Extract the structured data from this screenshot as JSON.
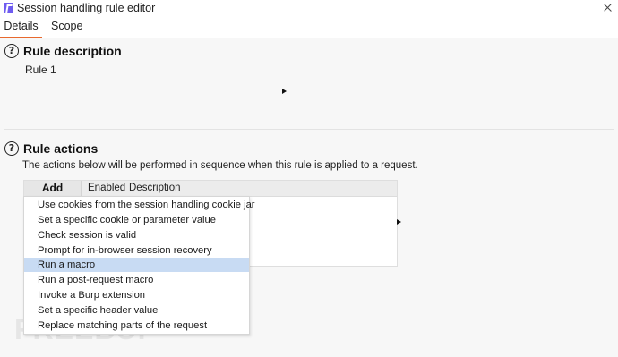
{
  "window": {
    "title": "Session handling rule editor",
    "accent_color": "#6f5cf0",
    "tab_underline_color": "#e8692e"
  },
  "tabs": [
    {
      "label": "Details",
      "active": true
    },
    {
      "label": "Scope",
      "active": false
    }
  ],
  "rule_description": {
    "heading": "Rule description",
    "help_icon": "question-circle-icon",
    "value": "Rule 1"
  },
  "rule_actions": {
    "heading": "Rule actions",
    "help_icon": "question-circle-icon",
    "help_text": "The actions below will be performed in sequence when this rule is applied to a request.",
    "add_label": "Add",
    "columns": [
      "Enabled",
      "Description"
    ]
  },
  "add_menu": {
    "items": [
      "Use cookies from the session handling cookie jar",
      "Set a specific cookie or parameter value",
      "Check session is valid",
      "Prompt for in-browser session recovery",
      "Run a macro",
      "Run a post-request macro",
      "Invoke a Burp extension",
      "Set a specific header value",
      "Replace matching parts of the request"
    ],
    "selected": "Run a macro",
    "selected_color": "#c8dbf3"
  },
  "watermark": "FREEBUF"
}
